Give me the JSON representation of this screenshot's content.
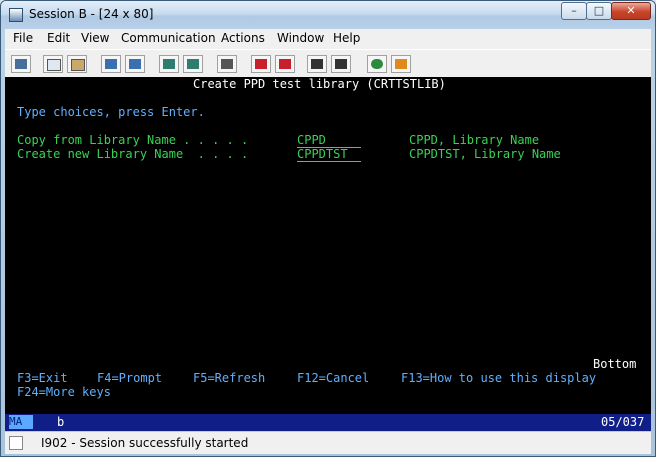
{
  "window": {
    "title": "Session B - [24 x 80]",
    "min_glyph": "–",
    "max_glyph": "□",
    "close_glyph": "✕"
  },
  "menu": [
    "File",
    "Edit",
    "View",
    "Communication",
    "Actions",
    "Window",
    "Help"
  ],
  "toolbar_icons": [
    "print-screen-icon",
    "copy-icon",
    "paste-icon",
    "send-file-icon",
    "receive-file-icon",
    "display-icon",
    "keypad-icon",
    "macro-icon",
    "record-macro-icon",
    "stop-macro-icon",
    "play-macro-icon",
    "pause-macro-icon",
    "globe-icon",
    "help-icon"
  ],
  "screen": {
    "title": "Create PPD test library (CRTTSTLIB)",
    "instruction": "Type choices, press Enter.",
    "fields": [
      {
        "label": "Copy from Library Name . . . . .",
        "value": "CPPD",
        "help": "CPPD, Library Name"
      },
      {
        "label": "Create new Library Name  . . . .",
        "value": "CPPDTST",
        "help": "CPPDTST, Library Name"
      }
    ],
    "bottom": "Bottom",
    "fkeys": [
      "F3=Exit",
      "F4=Prompt",
      "F5=Refresh",
      "F12=Cancel",
      "F13=How to use this display"
    ],
    "fkeys2": "F24=More keys"
  },
  "oia": {
    "mode": "MA",
    "indicator": "b",
    "cursor": "05/037"
  },
  "status": {
    "message": "I902 - Session successfully started"
  }
}
